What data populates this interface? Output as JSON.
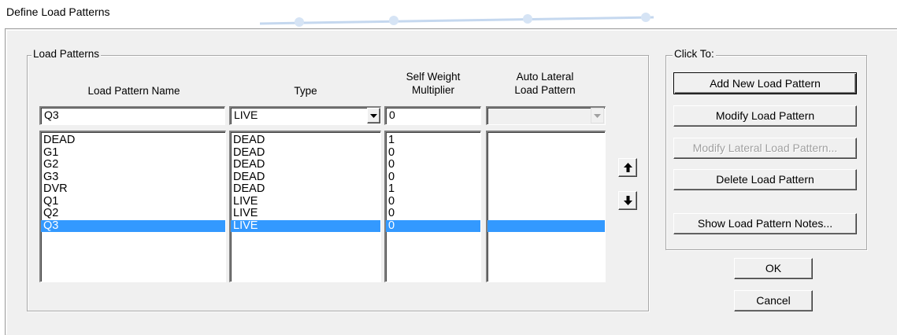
{
  "window": {
    "title": "Define Load Patterns"
  },
  "load_patterns": {
    "group_label": "Load Patterns",
    "headers": {
      "name": "Load Pattern Name",
      "type": "Type",
      "self_weight_line1": "Self Weight",
      "self_weight_line2": "Multiplier",
      "auto_lateral_line1": "Auto Lateral",
      "auto_lateral_line2": "Load Pattern"
    },
    "edit": {
      "name": "Q3",
      "type": "LIVE",
      "multiplier": "0",
      "auto_lateral": ""
    },
    "names": [
      "DEAD",
      "G1",
      "G2",
      "G3",
      "DVR",
      "Q1",
      "Q2",
      "Q3"
    ],
    "types": [
      "DEAD",
      "DEAD",
      "DEAD",
      "DEAD",
      "DEAD",
      "LIVE",
      "LIVE",
      "LIVE"
    ],
    "multipliers": [
      "1",
      "0",
      "0",
      "0",
      "1",
      "0",
      "0",
      "0"
    ],
    "selected_index": 7
  },
  "click_to": {
    "group_label": "Click To:",
    "add_new": "Add New Load Pattern",
    "modify": "Modify Load Pattern",
    "modify_lateral": "Modify Lateral Load Pattern...",
    "delete": "Delete Load Pattern",
    "show_notes": "Show Load Pattern Notes..."
  },
  "buttons": {
    "ok": "OK",
    "cancel": "Cancel"
  },
  "icons": {
    "move_up": "arrow-up-icon",
    "move_down": "arrow-down-icon",
    "dropdown": "chevron-down-icon"
  },
  "colors": {
    "selection": "#3399ff",
    "dialog_bg": "#f0f0f0"
  }
}
